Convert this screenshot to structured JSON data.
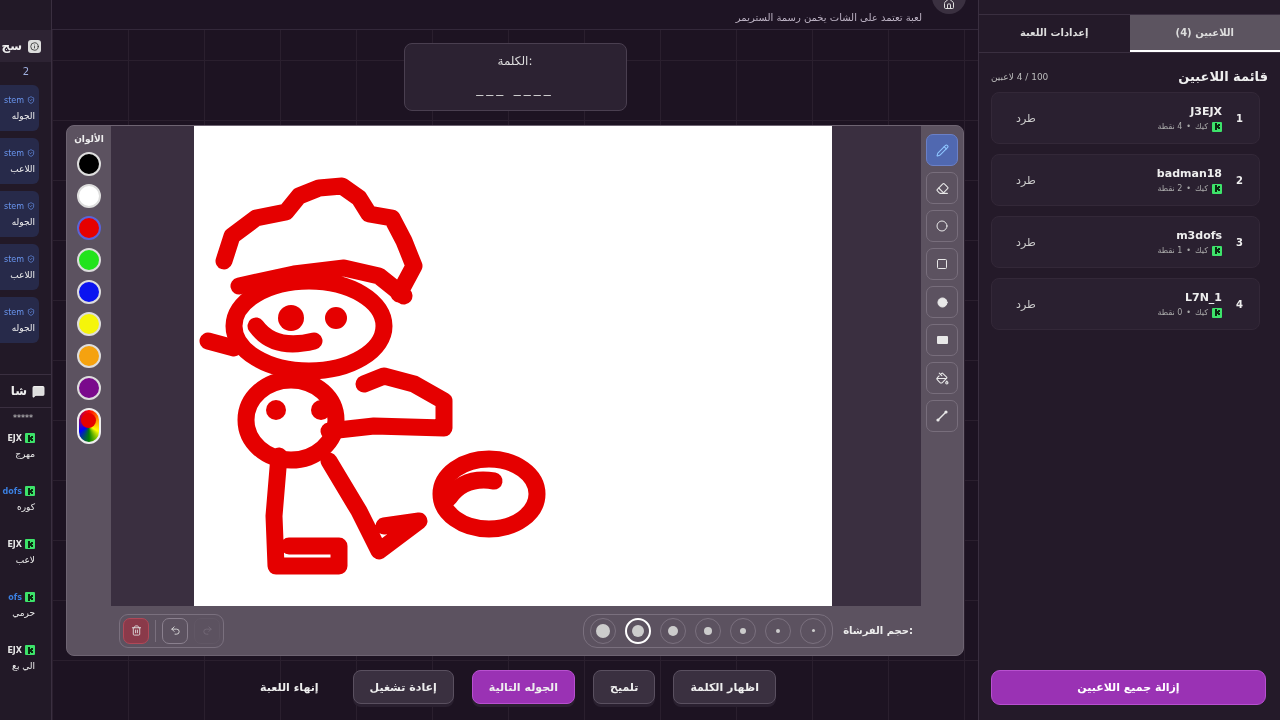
{
  "sidebar": {
    "log_title": "سج",
    "log_count": "2",
    "log_items": [
      {
        "source": "stem",
        "text": "الجوله"
      },
      {
        "source": "stem",
        "text": "اللاعب"
      },
      {
        "source": "stem",
        "text": "الجوله"
      },
      {
        "source": "stem",
        "text": "اللاعب"
      },
      {
        "source": "stem",
        "text": "الجوله"
      }
    ],
    "chat_title": "شا",
    "chat_hidden": "*****",
    "chat_messages": [
      {
        "user": "EJX",
        "color": "#e6e6e6",
        "text": "مهرج"
      },
      {
        "user": "dofs",
        "color": "#3b7fe0",
        "text": "كوره"
      },
      {
        "user": "EJX",
        "color": "#e6e6e6",
        "text": "لاعب"
      },
      {
        "user": "ofs",
        "color": "#3b7fe0",
        "text": "حرمي"
      },
      {
        "user": "EJX",
        "color": "#e6e6e6",
        "text": "الي بع"
      }
    ]
  },
  "header": {
    "subtitle": "لعبة تعتمد على الشات يخمن رسمة الستريمر"
  },
  "word": {
    "label": "الكلمة:",
    "blanks": "___ ____"
  },
  "palette": {
    "title": "الألوان",
    "colors": [
      {
        "color": "#000000",
        "selected": false
      },
      {
        "color": "#ffffff",
        "selected": false
      },
      {
        "color": "#e60000",
        "selected": true
      },
      {
        "color": "#22e31c",
        "selected": false
      },
      {
        "color": "#0a14f0",
        "selected": false
      },
      {
        "color": "#f5f50a",
        "selected": false
      },
      {
        "color": "#f5a20f",
        "selected": false
      },
      {
        "color": "#7a0a8c",
        "selected": false
      }
    ]
  },
  "tools": [
    {
      "kind": "pen",
      "selected": true
    },
    {
      "kind": "eraser",
      "selected": false
    },
    {
      "kind": "circle",
      "selected": false
    },
    {
      "kind": "square",
      "selected": false
    },
    {
      "kind": "filled-circle",
      "selected": false
    },
    {
      "kind": "filled-rect",
      "selected": false
    },
    {
      "kind": "fill",
      "selected": false
    },
    {
      "kind": "line",
      "selected": false
    }
  ],
  "controls": [
    {
      "kind": "clear",
      "disabled": false
    },
    {
      "kind": "undo",
      "disabled": false
    },
    {
      "kind": "redo",
      "disabled": true
    }
  ],
  "brush": {
    "label": "حجم الفرشاة:",
    "sizes": [
      {
        "selected": false
      },
      {
        "selected": true
      },
      {
        "selected": false
      },
      {
        "selected": false
      },
      {
        "selected": false
      },
      {
        "selected": false
      },
      {
        "selected": false
      }
    ]
  },
  "actions": [
    {
      "label": "اظهار الكلمة",
      "kind": "default"
    },
    {
      "label": "تلميح",
      "kind": "default"
    },
    {
      "label": "الجوله التالية",
      "kind": "primary"
    },
    {
      "label": "إعادة تشغيل",
      "kind": "default"
    },
    {
      "label": "إنهاء اللعبة",
      "kind": "plain"
    }
  ],
  "panel": {
    "tabs": [
      {
        "label": "اللاعبين (4)",
        "selected": true
      },
      {
        "label": "إعدادات اللعبة",
        "selected": false
      }
    ],
    "title": "قائمة اللاعبين",
    "count": "100 / 4 لاعبين",
    "players": [
      {
        "rank": "1",
        "name": "J3EJX",
        "platform": "كيك",
        "separator": "•",
        "points": "4 نقطة",
        "action": "طرد"
      },
      {
        "rank": "2",
        "name": "badman18",
        "platform": "كيك",
        "separator": "•",
        "points": "2 نقطة",
        "action": "طرد"
      },
      {
        "rank": "3",
        "name": "m3dofs",
        "platform": "كيك",
        "separator": "•",
        "points": "1 نقطة",
        "action": "طرد"
      },
      {
        "rank": "4",
        "name": "L7N_1",
        "platform": "كيك",
        "separator": "•",
        "points": "0 نقطة",
        "action": "طرد"
      }
    ],
    "remove_all": "إزالة جميع اللاعبين"
  }
}
